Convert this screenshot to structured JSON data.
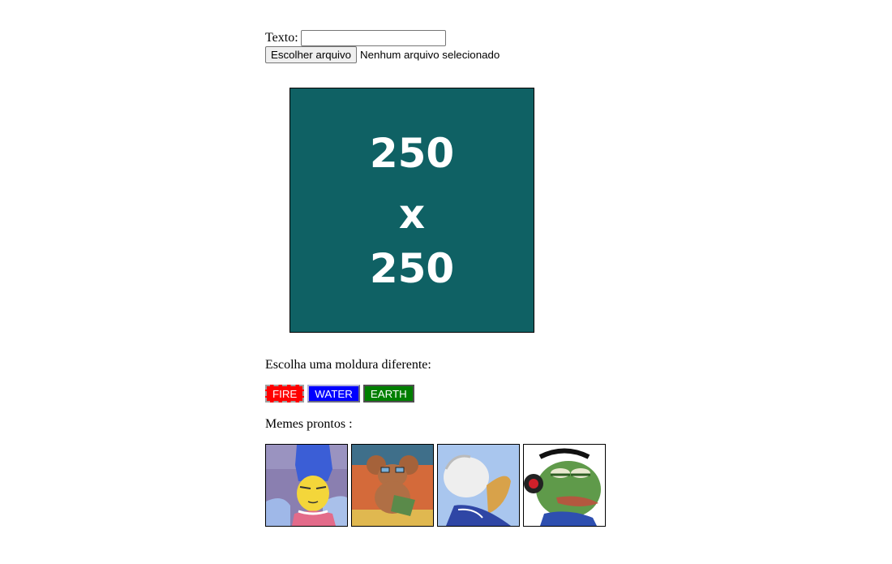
{
  "form": {
    "text_label": "Texto:",
    "text_value": "",
    "file_button_label": "Escolher arquivo",
    "file_status": "Nenhum arquivo selecionado"
  },
  "preview": {
    "line1": "250",
    "line2": "x",
    "line3": "250",
    "background": "#0f6164"
  },
  "frames": {
    "prompt": "Escolha uma moldura diferente:",
    "buttons": [
      {
        "label": "FIRE",
        "color": "#ff0000"
      },
      {
        "label": "WATER",
        "color": "#0000ff"
      },
      {
        "label": "EARTH",
        "color": "#007f00"
      }
    ]
  },
  "memes": {
    "prompt": "Memes prontos :",
    "thumbnails": [
      "marge-simpson-meme",
      "jerry-mouse-relaxing-meme",
      "donald-duck-meme",
      "pepe-frog-headphones-meme"
    ]
  }
}
